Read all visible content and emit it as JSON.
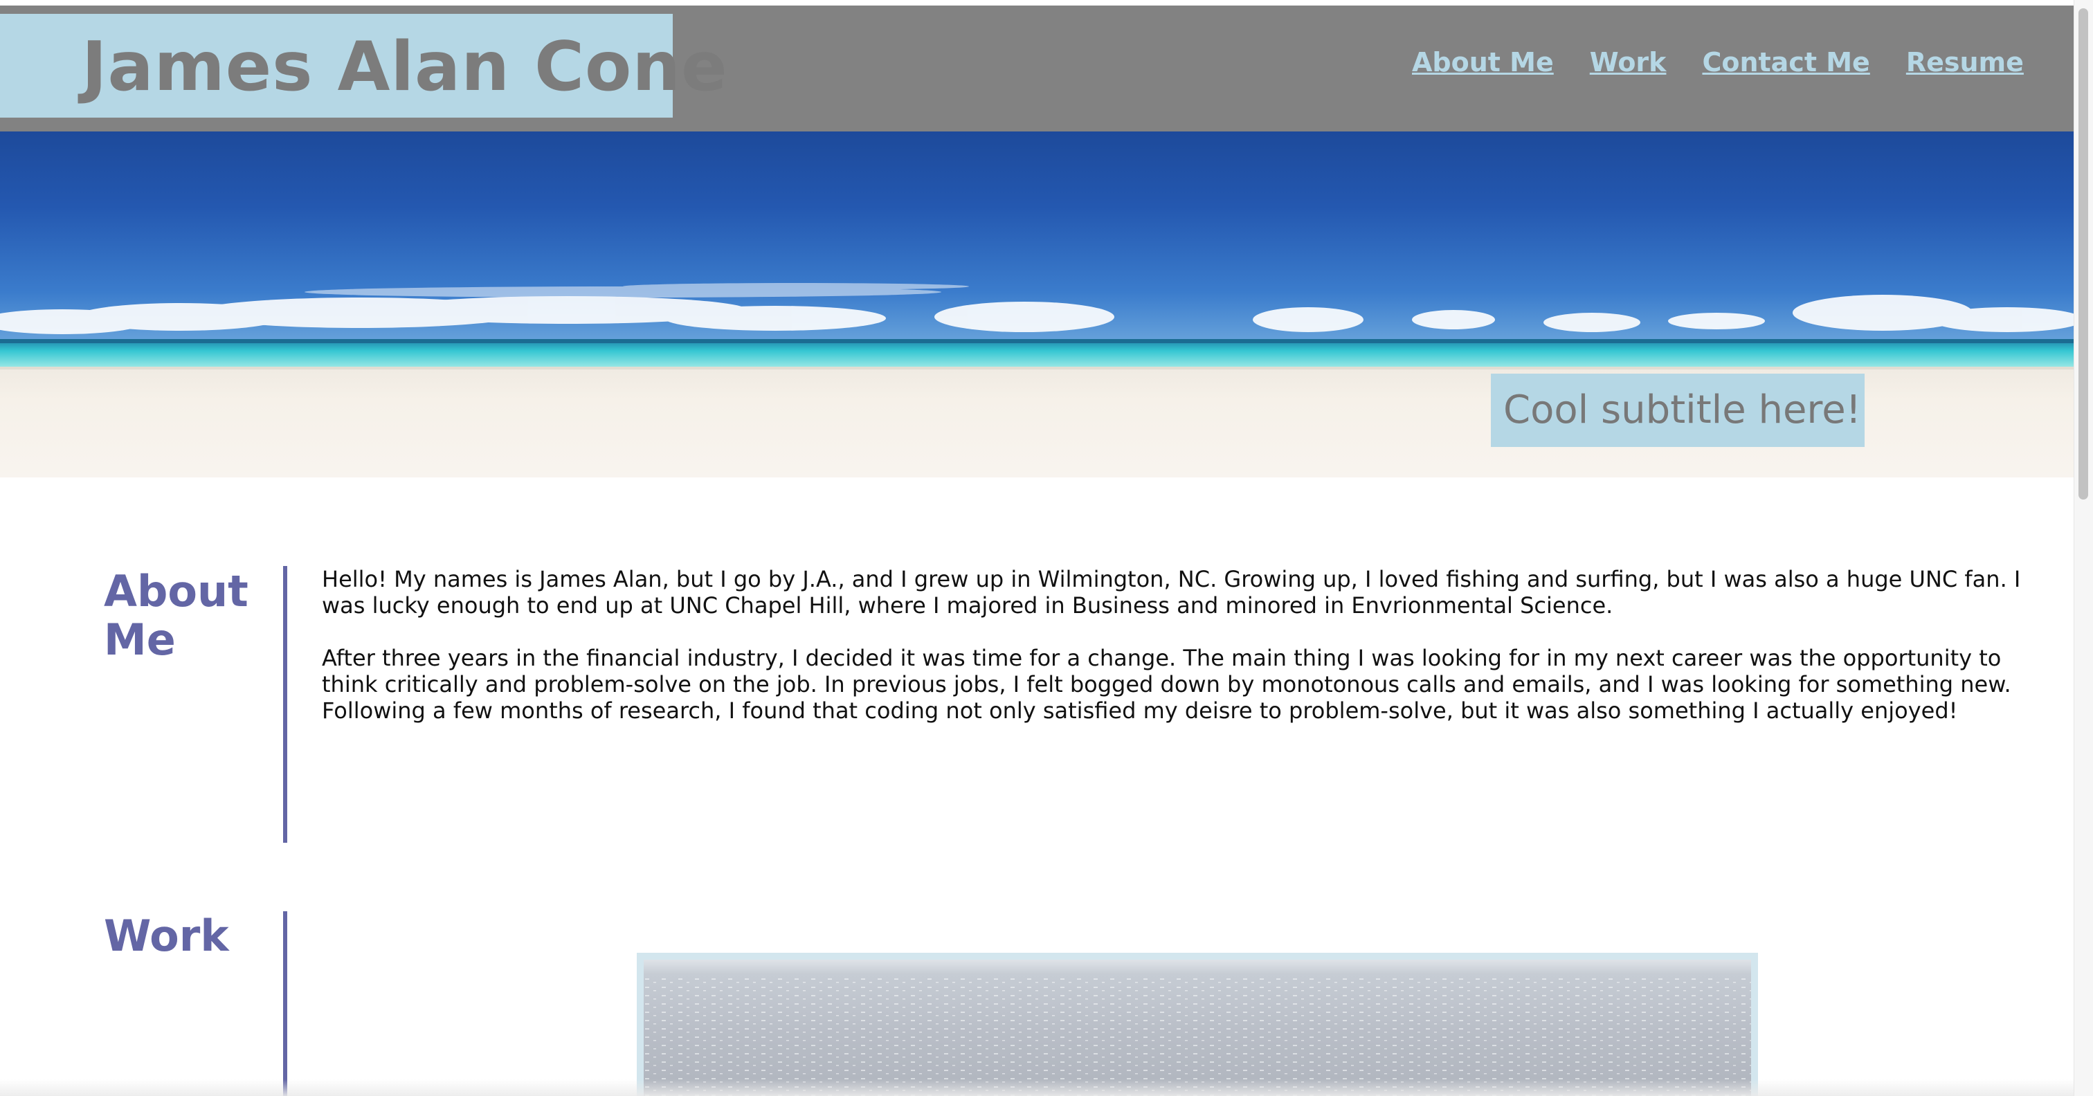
{
  "header": {
    "site_title": "James Alan Cone",
    "nav": [
      {
        "label": "About Me"
      },
      {
        "label": "Work"
      },
      {
        "label": "Contact Me"
      },
      {
        "label": "Resume"
      }
    ]
  },
  "hero": {
    "image": "beach-panorama",
    "subtitle": "Cool subtitle here!"
  },
  "about": {
    "heading": "About Me",
    "paragraphs": [
      "Hello! My names is James Alan, but I go by J.A., and I grew up in Wilmington, NC. Growing up, I loved fishing and surfing, but I was also a huge UNC fan. I was lucky enough to end up at UNC Chapel Hill, where I majored in Business and minored in Envrionmental Science.",
      "After three years in the financial industry, I decided it was time for a change. The main thing I was looking for in my next career was the opportunity to think critically and problem-solve on the job. In previous jobs, I felt bogged down by monotonous calls and emails, and I was looking for something new. Following a few months of research, I found that coding not only satisfied my deisre to problem-solve, but it was also something I actually enjoyed!"
    ]
  },
  "work": {
    "heading": "Work",
    "image": "ocean-water-photo"
  },
  "colors": {
    "header_bg": "#828282",
    "accent_light_blue": "#b5d7e5",
    "heading_purple": "#6366a5",
    "title_gray": "#7c7c7c"
  }
}
